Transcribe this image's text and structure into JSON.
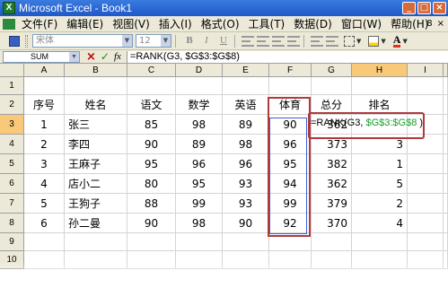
{
  "window": {
    "title": "Microsoft Excel - Book1",
    "app_icon": "excel-icon",
    "controls": [
      "_",
      "□",
      "×"
    ]
  },
  "menubar": {
    "items": [
      "文件(F)",
      "编辑(E)",
      "视图(V)",
      "插入(I)",
      "格式(O)",
      "工具(T)",
      "数据(D)",
      "窗口(W)",
      "帮助(H)"
    ],
    "right": [
      "-",
      "8",
      "×"
    ]
  },
  "toolbar": {
    "font": "宋体",
    "size": "12",
    "bold": "B",
    "italic": "I",
    "underline": "U",
    "font_color_glyph": "A"
  },
  "formula_bar": {
    "name_box": "SUM",
    "cancel": "×",
    "enter": "✓",
    "fx": "fx",
    "formula": "=RANK(G3, $G$3:$G$8)"
  },
  "columns": [
    "A",
    "B",
    "C",
    "D",
    "E",
    "F",
    "G",
    "H",
    "I"
  ],
  "row_numbers": [
    "1",
    "2",
    "3",
    "4",
    "5",
    "6",
    "7",
    "8",
    "9",
    "10"
  ],
  "headers": [
    "序号",
    "姓名",
    "语文",
    "数学",
    "英语",
    "体育",
    "总分",
    "排名"
  ],
  "rows": [
    {
      "idx": "1",
      "name": "张三",
      "chinese": "85",
      "math": "98",
      "english": "89",
      "pe": "90",
      "total": "362",
      "rank": ""
    },
    {
      "idx": "2",
      "name": "李四",
      "chinese": "90",
      "math": "89",
      "english": "98",
      "pe": "96",
      "total": "373",
      "rank": "3"
    },
    {
      "idx": "3",
      "name": "王麻子",
      "chinese": "95",
      "math": "96",
      "english": "96",
      "pe": "95",
      "total": "382",
      "rank": "1"
    },
    {
      "idx": "4",
      "name": "店小二",
      "chinese": "80",
      "math": "95",
      "english": "93",
      "pe": "94",
      "total": "362",
      "rank": "5"
    },
    {
      "idx": "5",
      "name": "王狗子",
      "chinese": "88",
      "math": "99",
      "english": "93",
      "pe": "99",
      "total": "379",
      "rank": "2"
    },
    {
      "idx": "6",
      "name": "孙二曼",
      "chinese": "90",
      "math": "98",
      "english": "90",
      "pe": "92",
      "total": "370",
      "rank": "4"
    }
  ],
  "edit_cell": {
    "prefix": "=RANK(G3,",
    "range": "$G$3:$G$8",
    "suffix": ")"
  },
  "accent_colors": {
    "title_bar": "#1f58c8",
    "highlight_box": "#b0393c",
    "range_ref": "#1c9b2c"
  }
}
